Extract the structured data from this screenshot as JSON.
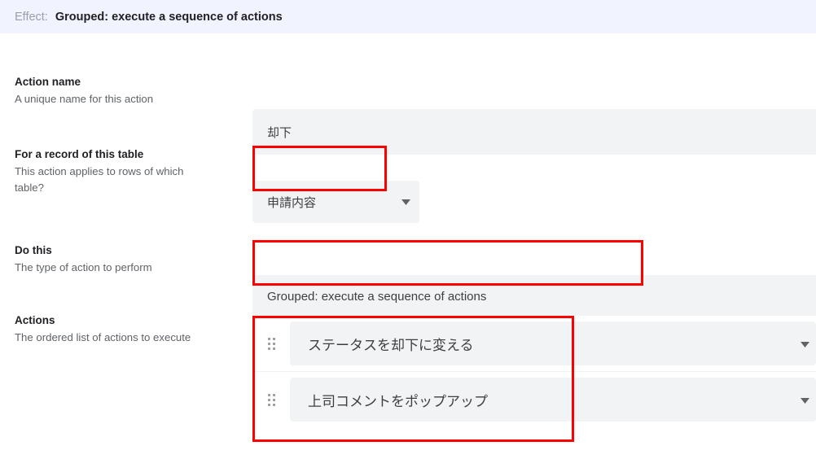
{
  "header": {
    "label": "Effect:",
    "value": "Grouped: execute a sequence of actions",
    "background": "#f1f3fe"
  },
  "fields": [
    {
      "title": "Action name",
      "description": "A unique name for this action",
      "control": "text-input",
      "value": "却下"
    },
    {
      "title": "For a record of this table",
      "description": "This action applies to rows of which table?",
      "control": "select",
      "value": "申請内容",
      "caret": "chevron-down-icon",
      "highlighted": true
    },
    {
      "title": "Do this",
      "description": "The type of action to perform",
      "control": "select",
      "value": "Grouped: execute a sequence of actions",
      "highlighted": true
    },
    {
      "title": "Actions",
      "description": "The ordered list of actions to execute",
      "control": "action-list",
      "highlighted": true
    }
  ],
  "actions": {
    "items": [
      {
        "drag_handle": "drag-handle-icon",
        "value": "ステータスを却下に変える",
        "caret": "chevron-down-icon"
      },
      {
        "drag_handle": "drag-handle-icon",
        "value": "上司コメントをポップアップ",
        "caret": "chevron-down-icon"
      }
    ]
  },
  "annotations": {
    "color": "#ff0000",
    "boxes": [
      {
        "name": "table-select-highlight"
      },
      {
        "name": "do-this-select-highlight"
      },
      {
        "name": "actions-list-highlight"
      }
    ]
  }
}
